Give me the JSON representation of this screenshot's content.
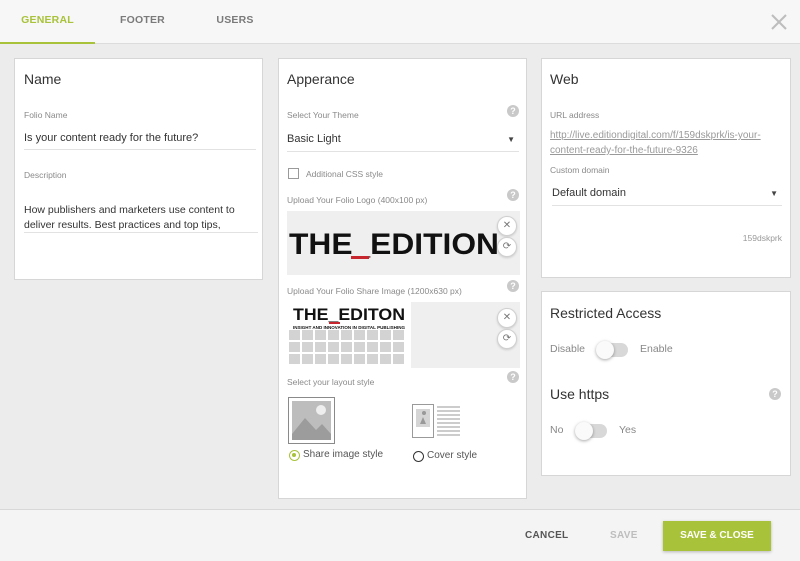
{
  "tabs": [
    {
      "label": "GENERAL"
    },
    {
      "label": "FOOTER"
    },
    {
      "label": "USERS"
    }
  ],
  "name_panel": {
    "title": "Name",
    "folio_name_label": "Folio Name",
    "folio_name_value": "Is your content ready for the future?",
    "description_label": "Description",
    "description_value": "How publishers and marketers use content to deliver results. Best practices and top tips, straight from the"
  },
  "appearance_panel": {
    "title": "Apperance",
    "theme_label": "Select Your Theme",
    "theme_value": "Basic Light",
    "additional_css_label": "Additional CSS style",
    "logo_label": "Upload Your Folio Logo (400x100 px)",
    "logo_text": "THE_EDITION",
    "share_image_label": "Upload Your Folio Share Image (1200x630 px)",
    "share_image_text": "THE_EDITON",
    "share_image_subtext": "INSIGHT AND INNOVATION IN DIGITAL PUBLISHING",
    "layout_label": "Select your layout style",
    "layout_option_share": "Share image style",
    "layout_option_cover": "Cover style",
    "selected_layout": "share"
  },
  "web_panel": {
    "title": "Web",
    "url_label": "URL address",
    "url_line1": "http://live.editiondigital.com/f/159dskprk/is-your-",
    "url_line2": "content-ready-for-the-future-9326",
    "domain_label": "Custom domain",
    "domain_value": "Default domain",
    "folio_id": "159dskprk"
  },
  "restricted_panel": {
    "title": "Restricted Access",
    "disable_label": "Disable",
    "enable_label": "Enable",
    "https_title": "Use https",
    "no_label": "No",
    "yes_label": "Yes"
  },
  "footer": {
    "cancel": "CANCEL",
    "save": "SAVE",
    "save_close": "SAVE & CLOSE"
  },
  "icons": {
    "close": "close-icon",
    "help": "help-icon",
    "remove": "remove-icon",
    "replace": "replace-icon",
    "dropdown": "caret-down-icon",
    "image_placeholder": "image-placeholder-icon",
    "cover_layout": "cover-layout-icon"
  },
  "colors": {
    "accent": "#a8c23a",
    "brand_red": "#c8262e"
  }
}
